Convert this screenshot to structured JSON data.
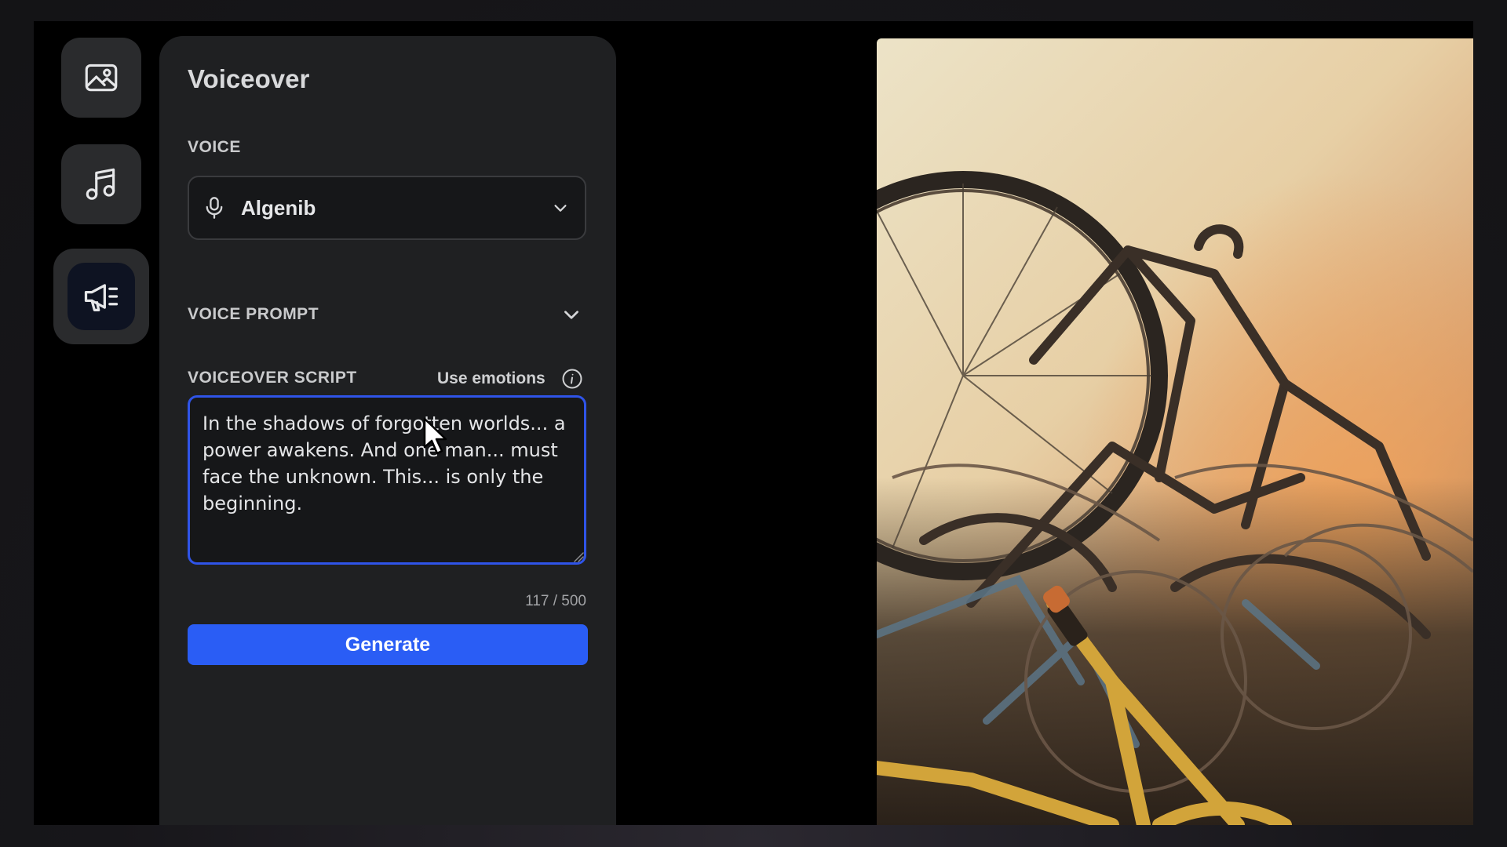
{
  "panel": {
    "title": "Voiceover",
    "voice_label": "VOICE",
    "voice_value": "Algenib",
    "voice_prompt_label": "VOICE PROMPT",
    "script_label": "VOICEOVER SCRIPT",
    "use_emotions_label": "Use emotions",
    "script_text": "In the shadows of forgotten worlds... a power awakens. And one man... must face the unknown. This... is only the beginning.",
    "char_count": "117 / 500",
    "generate_label": "Generate"
  },
  "rail": {
    "items": [
      {
        "icon": "image-icon",
        "active": false
      },
      {
        "icon": "music-note-icon",
        "active": false
      },
      {
        "icon": "megaphone-icon",
        "active": true
      }
    ]
  },
  "colors": {
    "accent": "#2a5df5",
    "panel_bg": "#1f2022",
    "field_bg": "#161719",
    "focus_border": "#2f54e8"
  }
}
